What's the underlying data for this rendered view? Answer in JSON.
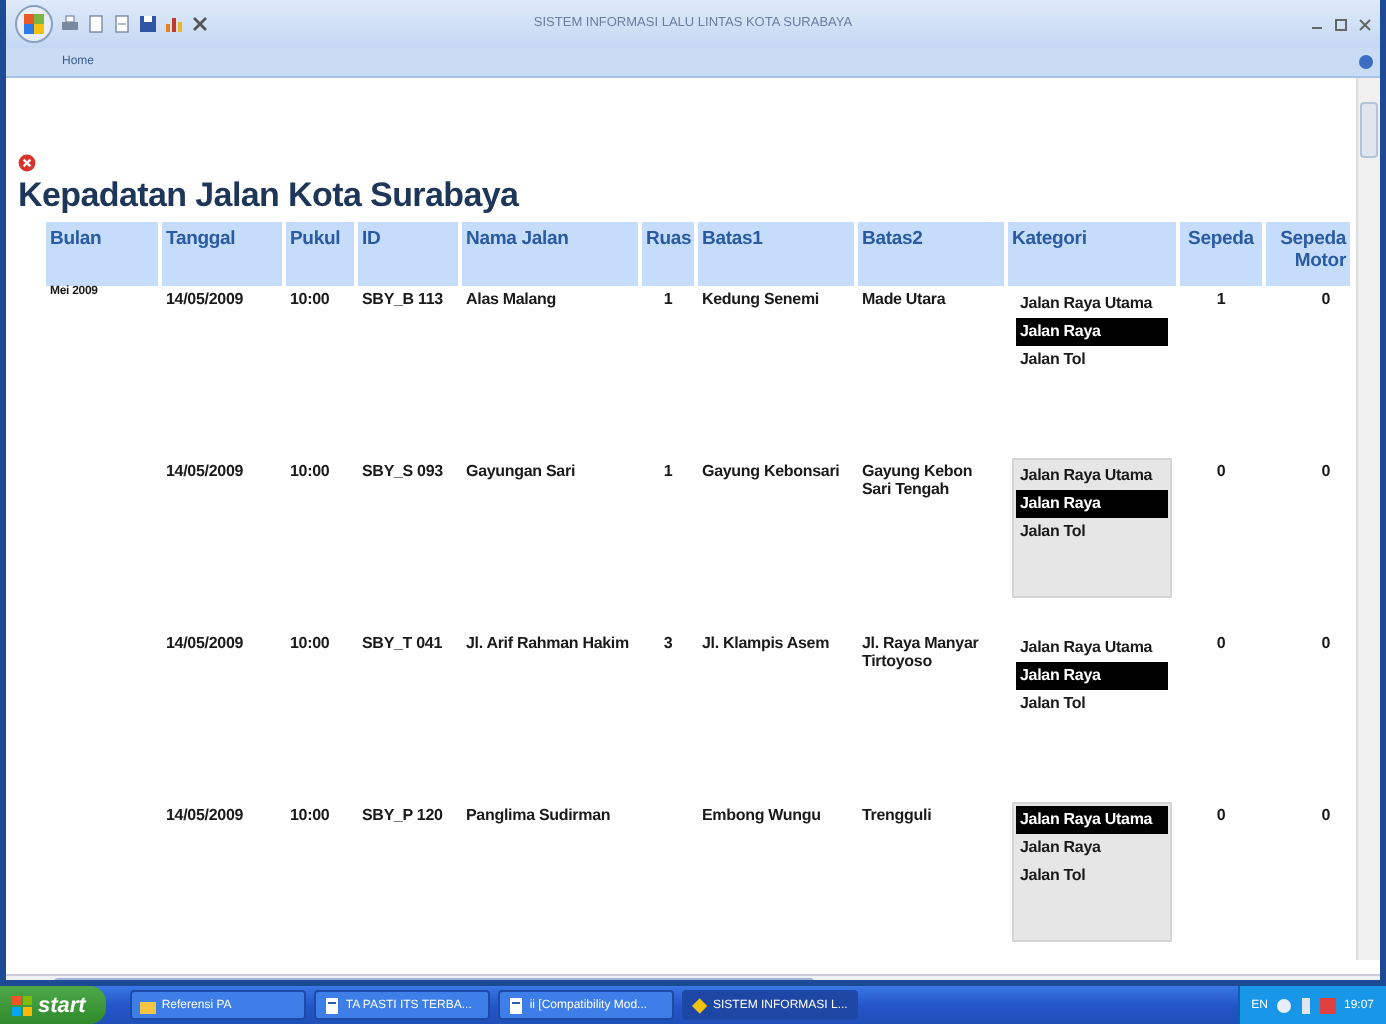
{
  "window": {
    "title": "SISTEM INFORMASI LALU LINTAS KOTA SURABAYA",
    "tab": "Home"
  },
  "page_title": "Kepadatan Jalan Kota Surabaya",
  "table": {
    "columns": [
      "Bulan",
      "Tanggal",
      "Pukul",
      "ID",
      "Nama Jalan",
      "Ruas",
      "Batas1",
      "Batas2",
      "Kategori",
      "Sepeda",
      "Sepeda Motor"
    ],
    "rows": [
      {
        "bulan": "Mei 2009",
        "tanggal": "14/05/2009",
        "pukul": "10:00",
        "id": "SBY_B 113",
        "nama_jalan": "Alas Malang",
        "ruas": "1",
        "batas1": "Kedung Senemi",
        "batas2": "Made Utara",
        "kategori": {
          "shaded": false,
          "options": [
            {
              "label": "Jalan Raya Utama",
              "selected": false
            },
            {
              "label": "Jalan Raya",
              "selected": true
            },
            {
              "label": "Jalan Tol",
              "selected": false
            }
          ]
        },
        "sepeda": "1",
        "sepeda_motor": "0"
      },
      {
        "tanggal": "14/05/2009",
        "pukul": "10:00",
        "id": "SBY_S 093",
        "nama_jalan": "Gayungan Sari",
        "ruas": "1",
        "batas1": "Gayung Kebonsari",
        "batas2": "Gayung Kebon Sari Tengah",
        "kategori": {
          "shaded": true,
          "options": [
            {
              "label": "Jalan Raya Utama",
              "selected": false
            },
            {
              "label": "Jalan Raya",
              "selected": true
            },
            {
              "label": "Jalan Tol",
              "selected": false
            }
          ]
        },
        "sepeda": "0",
        "sepeda_motor": "0"
      },
      {
        "tanggal": "14/05/2009",
        "pukul": "10:00",
        "id": "SBY_T 041",
        "nama_jalan": "Jl. Arif Rahman Hakim",
        "ruas": "3",
        "batas1": "Jl. Klampis Asem",
        "batas2": "Jl. Raya Manyar Tirtoyoso",
        "kategori": {
          "shaded": false,
          "options": [
            {
              "label": "Jalan Raya Utama",
              "selected": false
            },
            {
              "label": "Jalan Raya",
              "selected": true
            },
            {
              "label": "Jalan Tol",
              "selected": false
            }
          ]
        },
        "sepeda": "0",
        "sepeda_motor": "0"
      },
      {
        "tanggal": "14/05/2009",
        "pukul": "10:00",
        "id": "SBY_P 120",
        "nama_jalan": "Panglima Sudirman",
        "batas1": "Embong Wungu",
        "batas2": "Trengguli",
        "kategori": {
          "shaded": true,
          "options": [
            {
              "label": "Jalan Raya Utama",
              "selected": true
            },
            {
              "label": "Jalan Raya",
              "selected": false
            },
            {
              "label": "Jalan Tol",
              "selected": false
            }
          ]
        },
        "sepeda": "0",
        "sepeda_motor": "0"
      }
    ]
  },
  "taskbar": {
    "start": "start",
    "tasks": [
      {
        "label": "Referensi PA",
        "selected": false
      },
      {
        "label": "TA PASTI ITS TERBA...",
        "selected": false
      },
      {
        "label": "ii [Compatibility Mod...",
        "selected": false
      },
      {
        "label": "SISTEM INFORMASI L...",
        "selected": true
      }
    ],
    "language": "EN",
    "clock": "19:07"
  }
}
